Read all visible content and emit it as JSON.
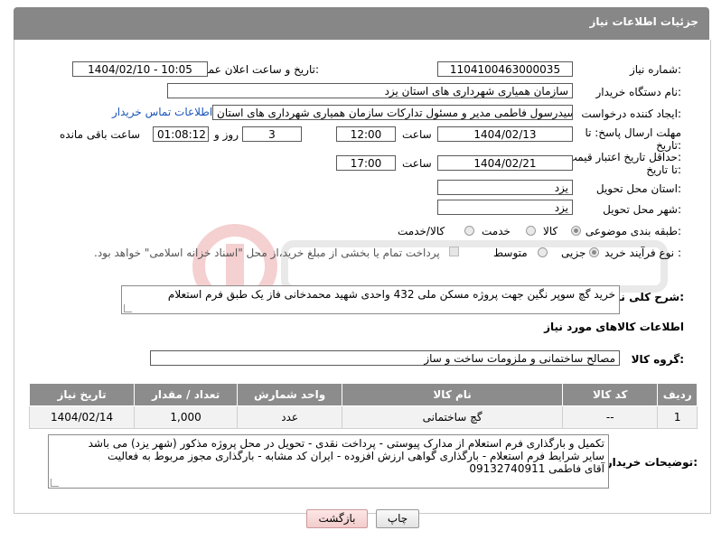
{
  "header": {
    "title": "جزئیات اطلاعات نیاز"
  },
  "form": {
    "need_number_label": "شماره نیاز:",
    "need_number": "1104100463000035",
    "announce_label": "تاریخ و ساعت اعلان عمومی:",
    "announce_value": "1404/02/10 - 10:05",
    "buyer_org_label": "نام دستگاه خریدار:",
    "buyer_org": "سازمان همیاری شهرداری های استان یزد",
    "requester_label": "ایجاد کننده درخواست:",
    "requester": "سیدرسول فاطمی مدیر و مسئول تدارکات سازمان همیاری شهرداری های استان",
    "contact_link": "اطلاعات تماس خریدار",
    "deadline_label_1": "مهلت ارسال پاسخ: تا",
    "deadline_label_2": "تاریخ:",
    "deadline_date": "1404/02/13",
    "time_label": "ساعت",
    "deadline_time": "12:00",
    "days_value": "3",
    "days_label": "روز و",
    "remaining_value": "01:08:12",
    "remaining_label": "ساعت باقی مانده",
    "validity_label_1": "حداقل تاریخ اعتبار قیمت:",
    "validity_label_2": "تا تاریخ:",
    "validity_date": "1404/02/21",
    "validity_time": "17:00",
    "province_label": "استان محل تحویل:",
    "province": "یزد",
    "city_label": "شهر محل تحویل:",
    "city": "یزد",
    "category_label": "طبقه بندی موضوعی:",
    "category_options": [
      "کالا",
      "خدمت",
      "کالا/خدمت"
    ],
    "process_label": "نوع فرآیند خرید :",
    "process_options": [
      "جزیی",
      "متوسط"
    ],
    "payment_note": "پرداخت تمام یا بخشی از مبلغ خرید،از محل \"اسناد خزانه اسلامی\" خواهد بود.",
    "description_label": "شرح کلی نیاز:",
    "description": "خرید گچ سوپر نگین جهت پروژه مسکن ملی 432 واحدی شهید محمدخانی فاز یک طبق فرم استعلام"
  },
  "goods": {
    "section_title": "اطلاعات کالاهای مورد نیاز",
    "group_label": "گروه کالا:",
    "group_value": "مصالح ساختمانی و ملزومات ساخت و ساز",
    "columns": [
      "ردیف",
      "کد کالا",
      "نام کالا",
      "واحد شمارش",
      "تعداد / مقدار",
      "تاریخ نیاز"
    ],
    "rows": [
      [
        "1",
        "--",
        "گچ ساختمانی",
        "عدد",
        "1,000",
        "1404/02/14"
      ]
    ]
  },
  "notes": {
    "label": "توضیحات خریدار:",
    "lines": [
      "تکمیل و بارگذاری فرم استعلام از مدارک پیوستی - پرداخت نقدی - تحویل در محل پروژه مذکور (شهر یزد) می باشد",
      "سایر شرایط فرم استعلام - بارگذاری گواهی ارزش افزوده - ایران کد مشابه - بارگذاری مجوز مربوط به فعالیت",
      "آقای فاطمی 09132740911"
    ]
  },
  "buttons": {
    "print": "چاپ",
    "back": "بازگشت"
  }
}
